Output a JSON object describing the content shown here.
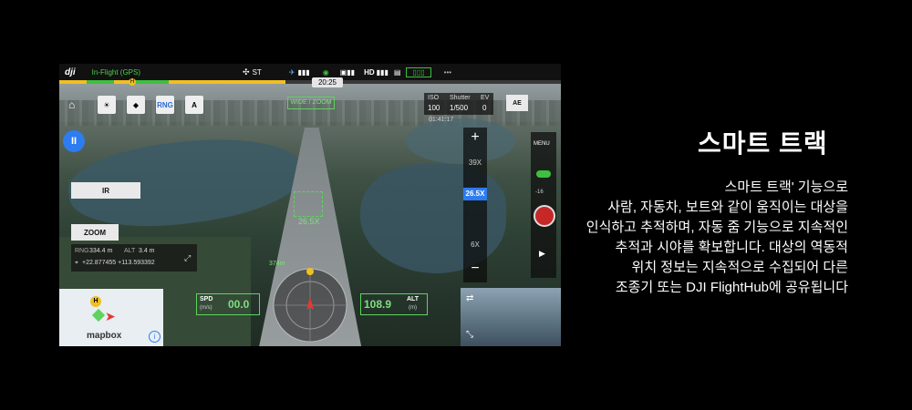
{
  "app": {
    "brand": "dji",
    "flight_status": "In-Flight (GPS)",
    "signal_items": [
      "ST",
      "HD"
    ],
    "more_label": "•••",
    "time": "20:25",
    "progress": 0.45,
    "progress_label_h": "H"
  },
  "toolbar": {
    "icons": [
      "sun-icon",
      "waypoint-icon",
      "RNG",
      "A"
    ]
  },
  "camera": {
    "iso_label": "ISO",
    "iso_value": "100",
    "shutter_label": "Shutter",
    "shutter_value": "1/500",
    "ev_label": "EV",
    "ev_value": "0",
    "ae_label": "AE",
    "record_time": "01:41:17",
    "wide_label": "WIDE / ZOOM",
    "target_zoom": "26.5X",
    "zoom_values": [
      "39X",
      "26.5X",
      "6X"
    ],
    "zoom_plus": "+",
    "zoom_minus": "−",
    "menu_label": "MENU",
    "slider_value": "-16"
  },
  "left_panel": {
    "ir_label": "IR",
    "zoom_label": "ZOOM",
    "rng_label": "RNG",
    "rng_value": "334.4 m",
    "alt_label": "ALT",
    "alt_value": "3.4 m",
    "coords": "+22.877455 +113.593392"
  },
  "telemetry": {
    "spd_label": "SPD",
    "spd_unit": "(m/s)",
    "spd_value": "00.0",
    "alt_label": "ALT",
    "alt_unit": "(m)",
    "alt_value": "108.9",
    "distance_tag": "374m"
  },
  "map": {
    "provider": "mapbox",
    "home_label": "H"
  },
  "text": {
    "title": "스마트 트랙",
    "lines": [
      "스마트 트랙' 기능으로",
      "사람, 자동차, 보트와 같이 움직이는 대상을",
      "인식하고 추적하며, 자동 줌 기능으로 지속적인",
      "추적과 시야를 확보합니다. 대상의 역동적",
      "위치 정보는 지속적으로 수집되어 다른",
      "조종기 또는 DJI FlightHub에 공유됩니다"
    ]
  }
}
